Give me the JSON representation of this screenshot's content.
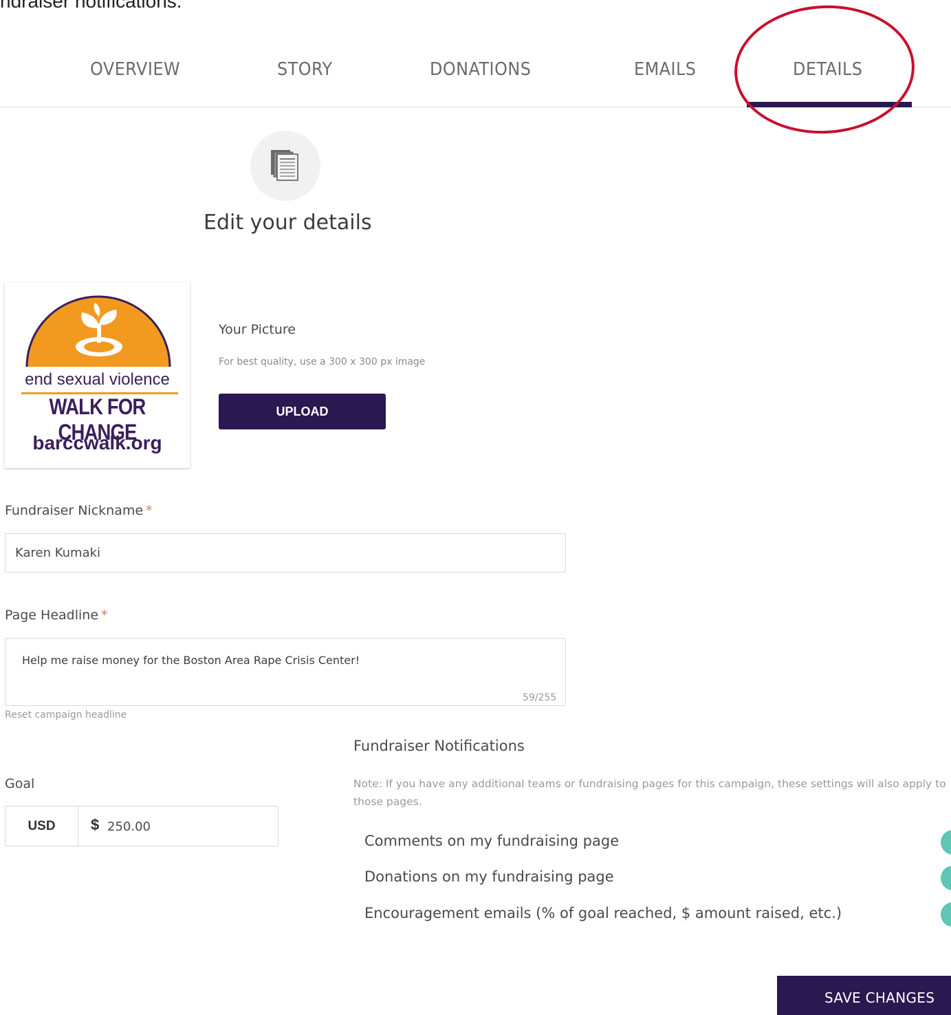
{
  "caption": "ndraiser notifications.",
  "tabs": [
    {
      "label": "OVERVIEW"
    },
    {
      "label": "STORY"
    },
    {
      "label": "DONATIONS"
    },
    {
      "label": "EMAILS"
    },
    {
      "label": "DETAILS",
      "active": true
    }
  ],
  "header": {
    "icon": "document-stack-icon",
    "title": "Edit your details"
  },
  "logo": {
    "line1": "end sexual violence",
    "line2": "WALK FOR CHANGE",
    "line3": "barccwalk.org"
  },
  "picture": {
    "label": "Your Picture",
    "hint": "For best quality, use a 300 x 300 px image",
    "upload_label": "UPLOAD"
  },
  "nickname": {
    "label": "Fundraiser Nickname",
    "required": "*",
    "value": "Karen Kumaki"
  },
  "headline": {
    "label": "Page Headline",
    "required": "*",
    "value": "Help me raise money for the Boston Area Rape Crisis Center!",
    "char_count": "59/255",
    "reset_label": "Reset campaign headline"
  },
  "goal": {
    "label": "Goal",
    "currency": "USD",
    "symbol": "$",
    "amount": "250.00"
  },
  "notifications": {
    "title": "Fundraiser Notifications",
    "note": "Note: If you have any additional teams or fundraising pages for this campaign, these settings will also apply to those pages.",
    "items": [
      {
        "label": "Comments on my fundraising page",
        "enabled": true
      },
      {
        "label": "Donations on my fundraising page",
        "enabled": true
      },
      {
        "label": "Encouragement emails (% of goal reached, $ amount raised, etc.)",
        "enabled": true
      }
    ]
  },
  "save_label": "SAVE CHANGES",
  "colors": {
    "accent": "#2a1850",
    "toggle_on": "#5ec6b4",
    "annotation": "#c8102e",
    "logo_orange": "#f29a1f"
  }
}
